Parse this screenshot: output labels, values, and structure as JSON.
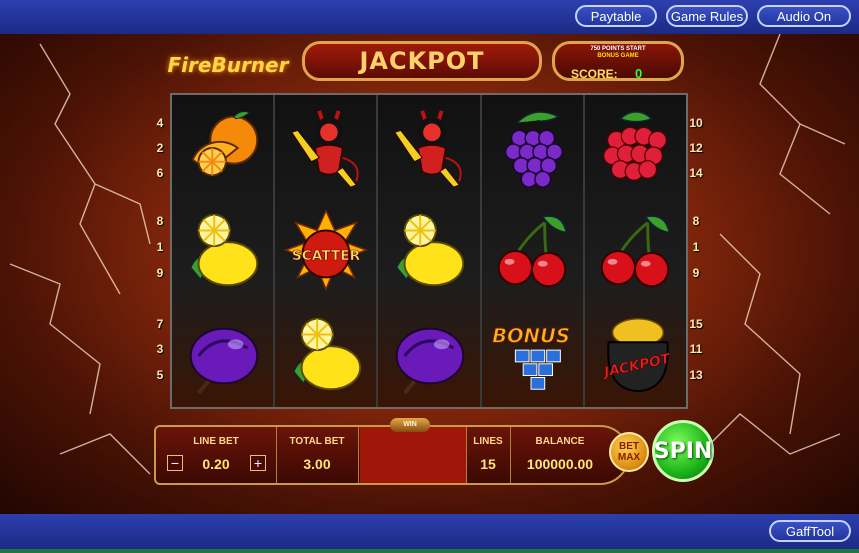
{
  "top_nav": {
    "paytable": "Paytable",
    "game_rules": "Game Rules",
    "audio": "Audio On"
  },
  "bottom_nav": {
    "gafftool": "GaffTool"
  },
  "header": {
    "logo_text": "FireBurner",
    "jackpot": "JACKPOT",
    "score_note_line1": "750 POINTS START",
    "score_note_line2": "BONUS GAME",
    "score_label": "SCORE:",
    "score_value": "0"
  },
  "reels": [
    [
      "orange",
      "lemon",
      "plum"
    ],
    [
      "devil-girl",
      "scatter",
      "lemon"
    ],
    [
      "devil-girl",
      "lemon",
      "plum"
    ],
    [
      "grapes",
      "cherries",
      "bonus"
    ],
    [
      "raspberry",
      "cherries",
      "jackpot"
    ]
  ],
  "paylines_left": [
    "4",
    "2",
    "6",
    "8",
    "1",
    "9",
    "7",
    "3",
    "5"
  ],
  "paylines_right": [
    "10",
    "12",
    "14",
    "8",
    "1",
    "9",
    "15",
    "11",
    "13"
  ],
  "controls": {
    "line_bet_label": "LINE BET",
    "line_bet_value": "0.20",
    "total_bet_label": "TOTAL BET",
    "total_bet_value": "3.00",
    "win_label": "WIN",
    "lines_label": "LINES",
    "lines_value": "15",
    "balance_label": "BALANCE",
    "balance_value": "100000.00",
    "bet_max_line1": "BET",
    "bet_max_line2": "MAX",
    "spin": "SPIN",
    "minus": "−",
    "plus": "+"
  },
  "symbol_text": {
    "scatter": "SCATTER",
    "bonus": "BONUS",
    "jackpot": "JACKPOT"
  },
  "colors": {
    "nav_blue": "#2136a0",
    "spin_green": "#1eb41a",
    "accent_gold": "#e0a54a"
  }
}
